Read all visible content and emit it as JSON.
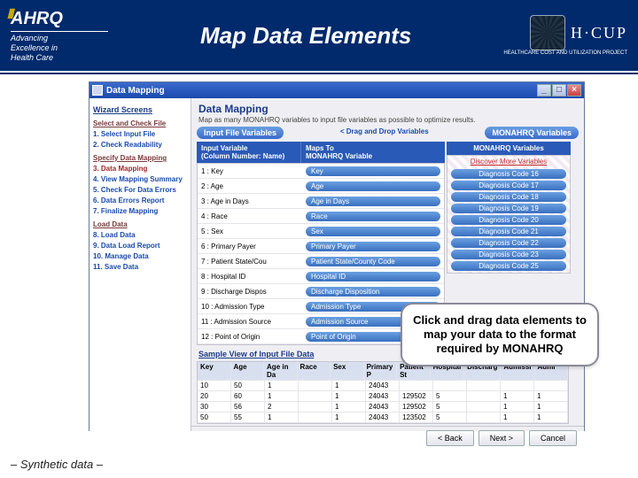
{
  "header": {
    "ahrq_logo": "AHRQ",
    "ahrq_tag1": "Advancing",
    "ahrq_tag2": "Excellence in",
    "ahrq_tag3": "Health Care",
    "title": "Map Data Elements",
    "hcup": "H·CUP",
    "hcup_sub": "HEALTHCARE COST AND UTILIZATION PROJECT"
  },
  "win": {
    "title": "Data Mapping",
    "min": "_",
    "max": "□",
    "close": "×"
  },
  "sidebar": {
    "head": "Wizard Screens",
    "g1": "Select and Check File",
    "s1": "1. Select Input File",
    "s2": "2. Check Readability",
    "g2": "Specify Data Mapping",
    "s3": "3. Data Mapping",
    "s4": "4. View Mapping Summary",
    "s5": "5. Check For Data Errors",
    "s6": "6. Data Errors Report",
    "s7": "7. Finalize Mapping",
    "g3": "Load Data",
    "s8": "8. Load Data",
    "s9": "9. Data Load Report",
    "s10": "10. Manage Data",
    "s11": "11. Save Data"
  },
  "main": {
    "title": "Data Mapping",
    "sub": "Map as many MONAHRQ variables to input file variables as possible to optimize results.",
    "leftPill": "Input File Variables",
    "between": "<   Drag and Drop Variables",
    "rightHead": "MONAHRQ Variables",
    "colA": "Input Variable\n(Column Number: Name)",
    "colB": "Maps To\nMONAHRQ Variable",
    "rightLink": "Discover More Variables",
    "rows": [
      {
        "col": "1 : Key",
        "map": "Key"
      },
      {
        "col": "2 : Age",
        "map": "Age"
      },
      {
        "col": "3 : Age in Days",
        "map": "Age in Days"
      },
      {
        "col": "4 : Race",
        "map": "Race"
      },
      {
        "col": "5 : Sex",
        "map": "Sex"
      },
      {
        "col": "6 : Primary Payer",
        "map": "Primary Payer"
      },
      {
        "col": "7 : Patient State/Cou",
        "map": "Patient State/County Code"
      },
      {
        "col": "8 : Hospital ID",
        "map": "Hospital ID"
      },
      {
        "col": "9 : Discharge Dispos",
        "map": "Discharge Disposition"
      },
      {
        "col": "10 : Admission Type",
        "map": "Admission Type"
      },
      {
        "col": "11 : Admission Source",
        "map": "Admission Source"
      },
      {
        "col": "12 : Point of Origin",
        "map": "Point of Origin"
      }
    ],
    "avail": [
      "Diagnosis Code 16",
      "Diagnosis Code 17",
      "Diagnosis Code 18",
      "Diagnosis Code 19",
      "Diagnosis Code 20",
      "Diagnosis Code 21",
      "Diagnosis Code 22",
      "Diagnosis Code 23",
      "Diagnosis Code 25"
    ],
    "sampleHead": "Sample View of Input File Data",
    "sampleCols": [
      "Key",
      "Age",
      "Age in Da",
      "Race",
      "Sex",
      "Primary P",
      "Patient St",
      "Hospital",
      "Discharg",
      "Admissi",
      "Admi"
    ],
    "sampleRows": [
      [
        "10",
        "50",
        "1",
        "",
        "1",
        "24043",
        "",
        "",
        "",
        "",
        ""
      ],
      [
        "20",
        "60",
        "1",
        "",
        "1",
        "24043",
        "129502",
        "5",
        "",
        "1",
        "1"
      ],
      [
        "30",
        "56",
        "2",
        "",
        "1",
        "24043",
        "129502",
        "5",
        "",
        "1",
        "1"
      ],
      [
        "50",
        "55",
        "1",
        "",
        "1",
        "24043",
        "123502",
        "5",
        "",
        "1",
        "1"
      ]
    ],
    "back": "< Back",
    "next": "Next >",
    "cancel": "Cancel"
  },
  "callout": "Click and drag data elements to map your data to the format required by MONAHRQ",
  "footer": "– Synthetic data –"
}
